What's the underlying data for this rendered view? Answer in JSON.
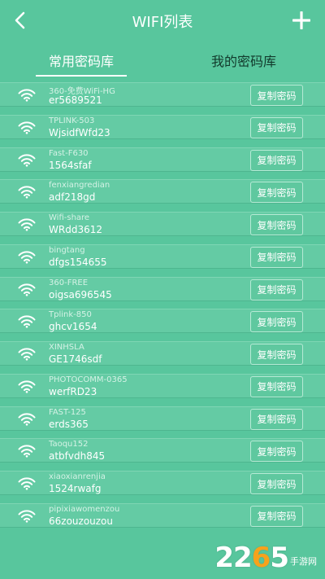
{
  "header": {
    "title": "WIFI列表",
    "back_icon": "chevron-left-icon",
    "add_icon": "plus-icon"
  },
  "tabs": [
    {
      "label": "常用密码库",
      "active": true
    },
    {
      "label": "我的密码库",
      "active": false
    }
  ],
  "copy_label": "复制密码",
  "networks": [
    {
      "ssid": "360-免费WiFi-HG",
      "password": "er5689521"
    },
    {
      "ssid": "TPLINK-503",
      "password": "WjsidfWfd23"
    },
    {
      "ssid": "Fast-F630",
      "password": "1564sfaf"
    },
    {
      "ssid": "fenxiangredian",
      "password": "adf218gd"
    },
    {
      "ssid": "Wifi-share",
      "password": "WRdd3612"
    },
    {
      "ssid": "bingtang",
      "password": "dfgs154655"
    },
    {
      "ssid": "360-FREE",
      "password": "oigsa696545"
    },
    {
      "ssid": "Tplink-850",
      "password": "ghcv1654"
    },
    {
      "ssid": "XINHSLA",
      "password": "GE1746sdf"
    },
    {
      "ssid": "PHOTOCOMM-0365",
      "password": "werfRD23"
    },
    {
      "ssid": "FAST-125",
      "password": "erds365"
    },
    {
      "ssid": "Taoqu152",
      "password": "atbfvdh845"
    },
    {
      "ssid": "xiaoxianrenjia",
      "password": "1524rwafg"
    },
    {
      "ssid": "pipixiawomenzou",
      "password": "66zouzouzou"
    }
  ],
  "watermark": {
    "number_a": "22",
    "number_b": "6",
    "number_c": "5",
    "text": "手游网"
  },
  "colors": {
    "background": "#58c69d",
    "row": "#64cba4",
    "inactive_tab": "#123a2c",
    "watermark_accent": "#f7a21c"
  }
}
